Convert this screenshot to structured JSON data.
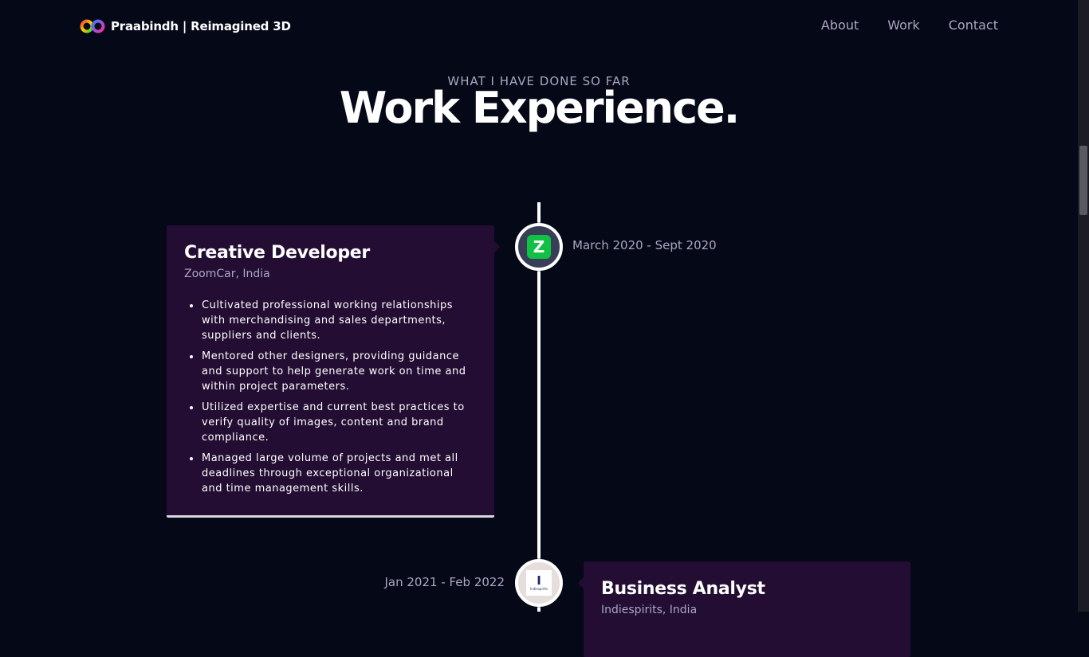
{
  "navbar": {
    "brand": "Praabindh | Reimagined 3D",
    "links": [
      "About",
      "Work",
      "Contact"
    ]
  },
  "section": {
    "subtitle": "WHAT I HAVE DONE SO FAR",
    "title": "Work Experience."
  },
  "experiences": [
    {
      "title": "Creative Developer",
      "company": "ZoomCar, India",
      "date": "March 2020 - Sept 2020",
      "icon": "zoomcar-logo-icon",
      "icon_letter": "Z",
      "points": [
        "Cultivated professional working relationships with merchandising and sales departments, suppliers and clients.",
        "Mentored other designers, providing guidance and support to help generate work on time and within project parameters.",
        "Utilized expertise and current best practices to verify quality of images, content and brand compliance.",
        "Managed large volume of projects and met all deadlines through exceptional organizational and time management skills."
      ]
    },
    {
      "title": "Business Analyst",
      "company": "Indiespirits, India",
      "date": "Jan 2021 - Feb 2022",
      "icon": "indiespirits-logo-icon",
      "icon_letter": "I",
      "icon_word": "Indiespirits"
    }
  ],
  "colors": {
    "background": "#050816",
    "card": "#230d33",
    "secondary_text": "#aaa6c3",
    "zoom_green": "#10c146"
  }
}
